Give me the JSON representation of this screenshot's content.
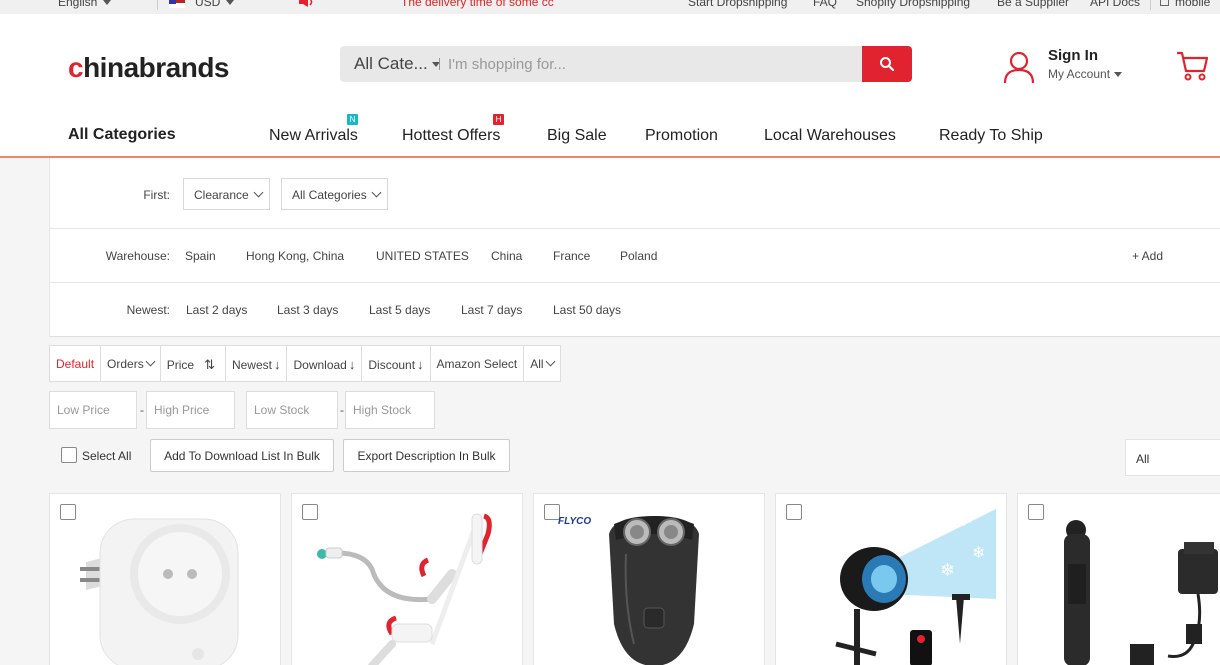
{
  "topbar": {
    "language": "English",
    "currency": "USD",
    "notice": "The delivery time of some cc",
    "links": [
      "Start Dropshipping",
      "FAQ",
      "Shopify Dropshipping",
      "Be a Supplier",
      "API Docs"
    ],
    "mobile": "mobile"
  },
  "header": {
    "logo_prefix": "c",
    "logo_text": "hinabrands",
    "search_category": "All Cate...",
    "search_placeholder": "I'm shopping for...",
    "sign_in": "Sign In",
    "my_account": "My Account"
  },
  "nav": {
    "all_categories": "All Categories",
    "items": [
      "New Arrivals",
      "Hottest Offers",
      "Big Sale",
      "Promotion",
      "Local Warehouses",
      "Ready To Ship"
    ],
    "badges": {
      "new": "N",
      "hot": "H"
    }
  },
  "filters": {
    "first_label": "First:",
    "first_dropdowns": [
      "Clearance",
      "All Categories"
    ],
    "warehouse_label": "Warehouse:",
    "warehouses": [
      "Spain",
      "Hong Kong, China",
      "UNITED STATES",
      "China",
      "France",
      "Poland"
    ],
    "add": "+ Add",
    "newest_label": "Newest:",
    "newest_options": [
      "Last 2 days",
      "Last 3 days",
      "Last 5 days",
      "Last 7 days",
      "Last 50 days"
    ]
  },
  "sort": {
    "items": [
      "Default",
      "Orders",
      "Price",
      "Newest",
      "Download",
      "Discount",
      "Amazon Select",
      "All"
    ]
  },
  "range": {
    "low_price": "Low Price",
    "high_price": "High Price",
    "low_stock": "Low Stock",
    "high_stock": "High Stock",
    "dash": "-"
  },
  "bulk": {
    "select_all": "Select All",
    "add_download": "Add To Download List In Bulk",
    "export_desc": "Export Description In Bulk",
    "right_select": "All"
  },
  "products": {
    "brand_label_3": "FLYCO"
  },
  "colors": {
    "brand_red": "#e0232e",
    "badge_teal": "#19b8c9",
    "nav_underline": "#f0846e"
  }
}
